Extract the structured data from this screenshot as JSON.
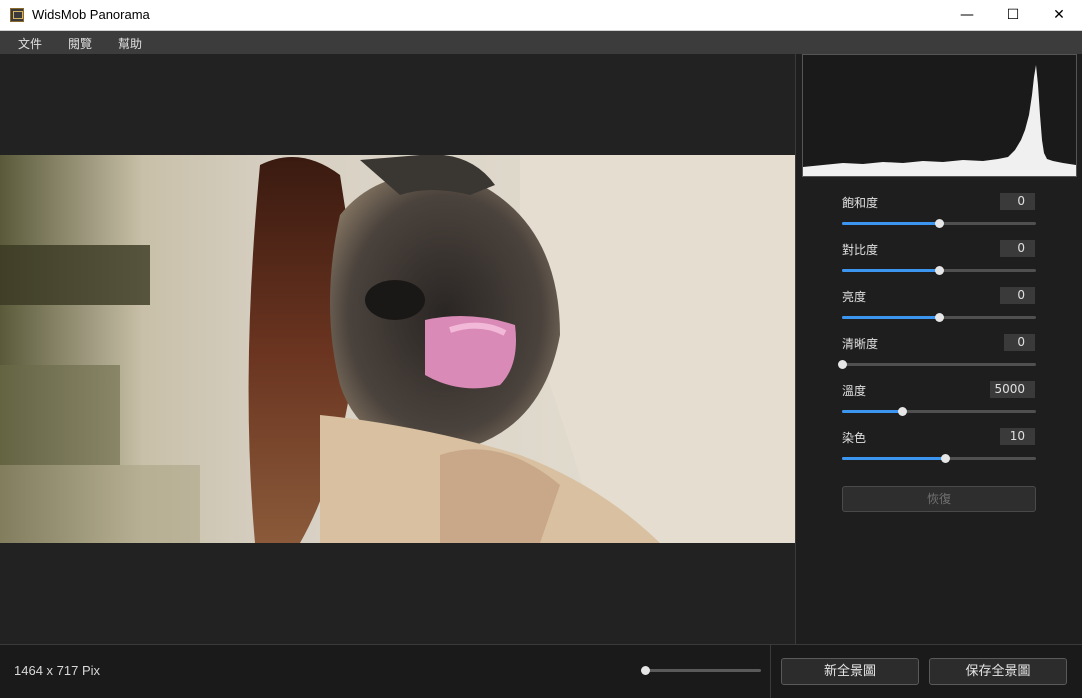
{
  "window": {
    "title": "WidsMob Panorama",
    "minimize_glyph": "—",
    "maximize_glyph": "☐",
    "close_glyph": "✕"
  },
  "menu": {
    "items": [
      {
        "label": "文件"
      },
      {
        "label": "閱覽"
      },
      {
        "label": "幫助"
      }
    ]
  },
  "adjustments": [
    {
      "label": "飽和度",
      "value": "0",
      "level": 0.5
    },
    {
      "label": "對比度",
      "value": "0",
      "level": 0.5
    },
    {
      "label": "亮度",
      "value": "0",
      "level": 0.5
    },
    {
      "label": "清晰度",
      "value": "0",
      "level": 0.0
    },
    {
      "label": "溫度",
      "value": "5000",
      "level": 0.31
    },
    {
      "label": "染色",
      "value": "10",
      "level": 0.53
    }
  ],
  "reset_label": "恢復",
  "status": {
    "dimensions": "1464 x 717 Pix",
    "zoom_level": 0.0
  },
  "buttons": {
    "new_panorama": "新全景圖",
    "save_panorama": "保存全景圖"
  },
  "colors": {
    "accent": "#3c96f0",
    "background": "#222222",
    "menubar": "#3c3c3c"
  }
}
